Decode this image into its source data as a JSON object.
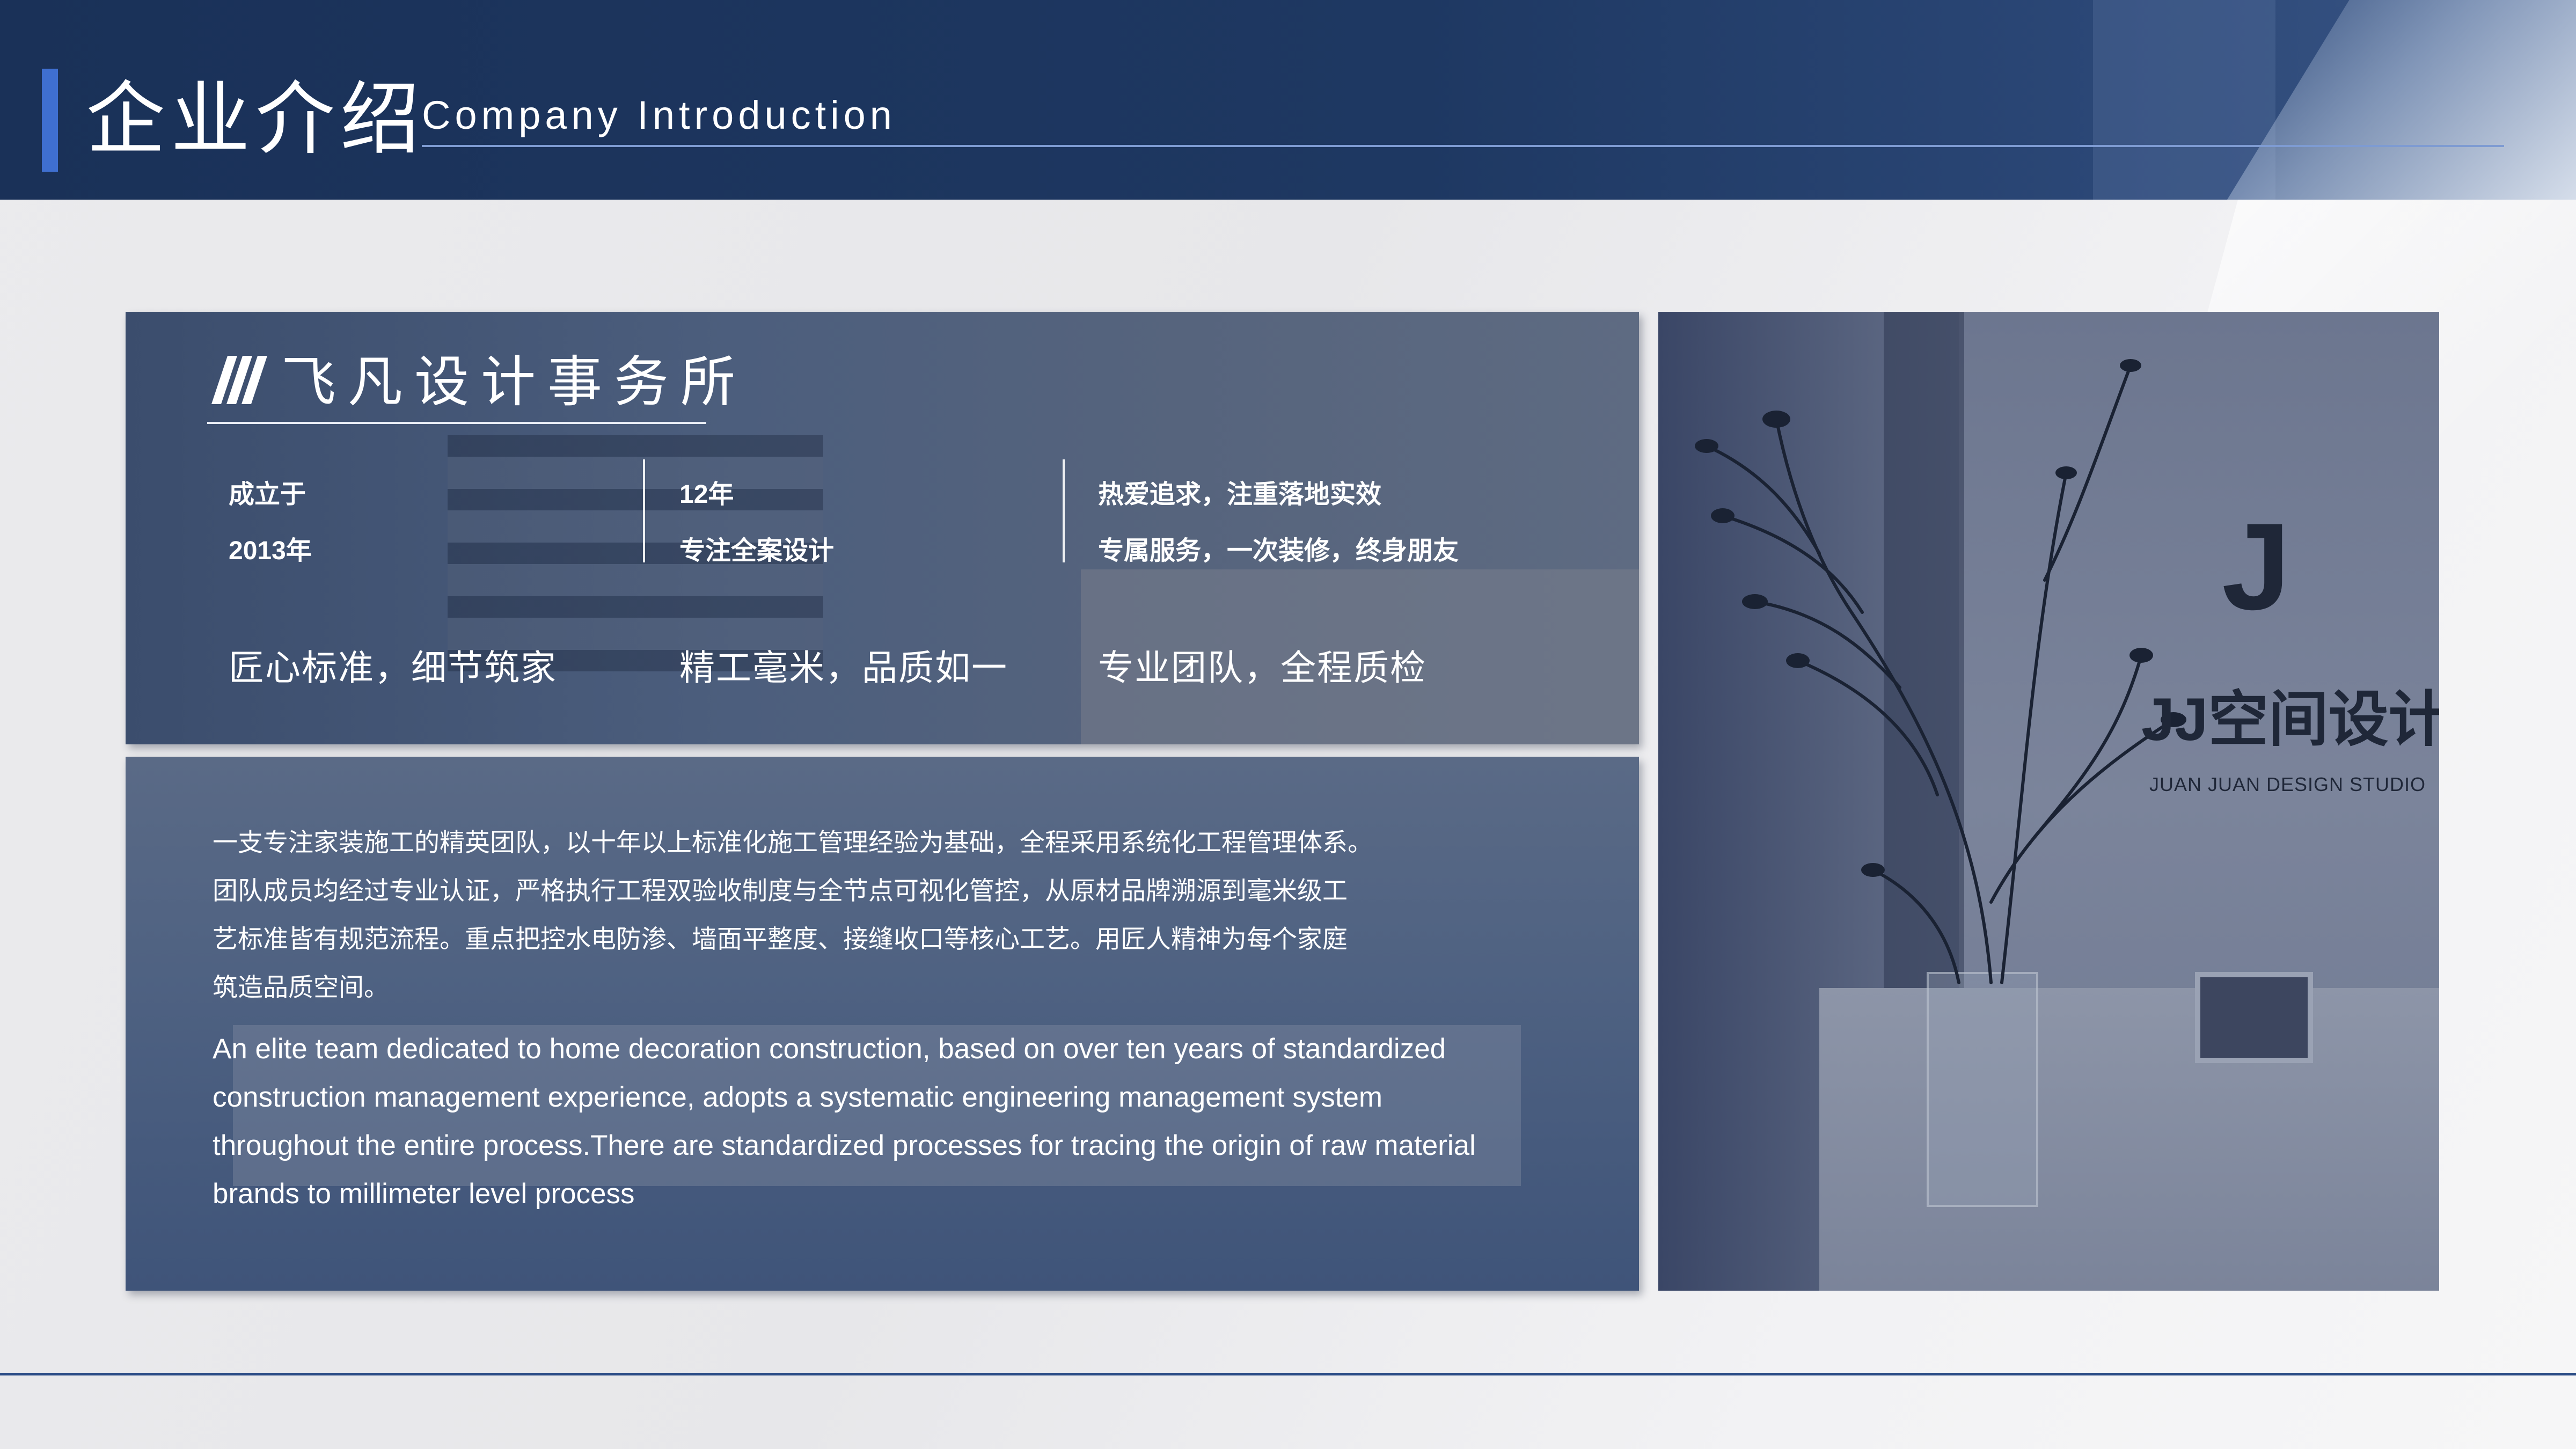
{
  "header": {
    "title_cn": "企业介绍",
    "title_en": "Company Introduction"
  },
  "intro_card": {
    "logo_name": "飞凡设计事务所",
    "columns": [
      {
        "line1": "成立于",
        "line2": "2013年"
      },
      {
        "line1": "12年",
        "line2": "专注全案设计"
      },
      {
        "line1": "热爱追求，注重落地实效",
        "line2": "专属服务，一次装修，终身朋友"
      }
    ],
    "slogans": [
      "匠心标准，细节筑家",
      "精工毫米，品质如一",
      "专业团队，全程质检"
    ]
  },
  "description": {
    "cn_lines": [
      "一支专注家装施工的精英团队，以十年以上标准化施工管理经验为基础，全程采用系统化工程管理体系。",
      "团队成员均经过专业认证，严格执行工程双验收制度与全节点可视化管控，从原材品牌溯源到毫米级工",
      "艺标准皆有规范流程。重点把控水电防渗、墙面平整度、接缝收口等核心工艺。用匠人精神为每个家庭",
      "筑造品质空间。"
    ],
    "en_lines": [
      "An elite team dedicated to home decoration construction, based on over ten years of standardized",
      "construction management experience, adopts a systematic engineering management system",
      "throughout the entire process.There are standardized processes for tracing the origin of raw material",
      "brands to millimeter level process"
    ]
  },
  "photo": {
    "brand_text": "JJ空间设计",
    "studio_text": "JUAN JUAN DESIGN STUDIO"
  },
  "colors": {
    "header_bg": "#1e3862",
    "accent_bar": "#3f6fd0",
    "bottom_rule": "#2b4c86"
  }
}
